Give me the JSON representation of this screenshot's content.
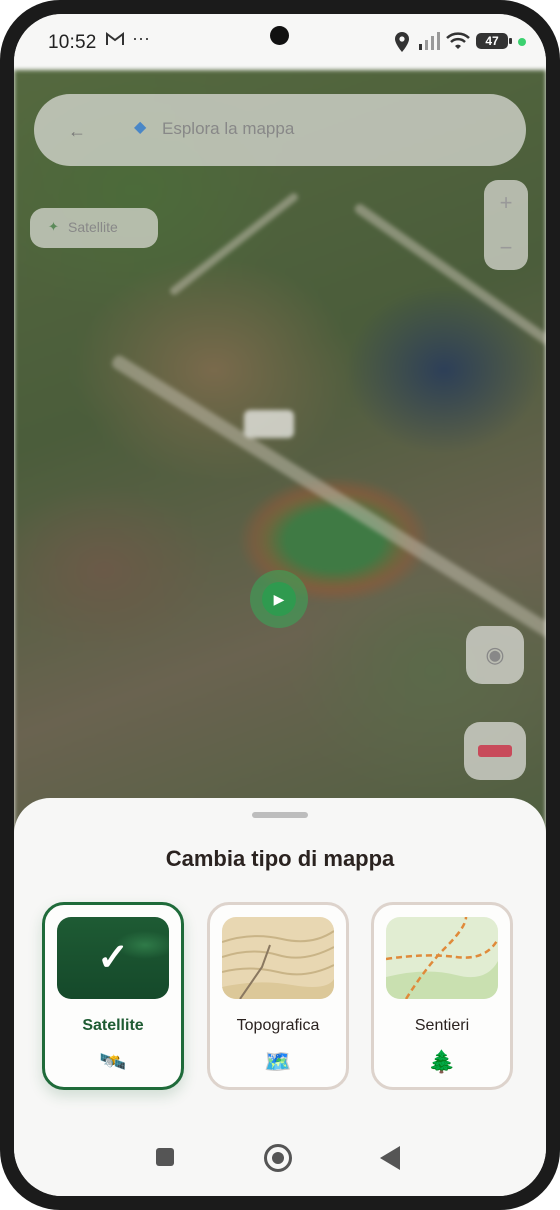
{
  "status_bar": {
    "time": "10:52",
    "notification_icons": [
      "gmail-icon",
      "more-dots-icon"
    ],
    "system_icons": [
      "location-icon",
      "signal-icon",
      "wifi-icon",
      "battery-icon"
    ],
    "battery_level": "47",
    "privacy_indicator_color": "#3bd16f"
  },
  "search": {
    "placeholder": "Esplora la mappa"
  },
  "map": {
    "layer_chip_label": "Satellite",
    "zoom_in_label": "+",
    "zoom_out_label": "−"
  },
  "sheet": {
    "title": "Cambia tipo di mappa",
    "options": [
      {
        "label": "Satellite",
        "icon": "🛰️",
        "selected": true
      },
      {
        "label": "Topografica",
        "icon": "🗺️",
        "selected": false
      },
      {
        "label": "Sentieri",
        "icon": "🌲",
        "selected": false
      }
    ],
    "selected_check": "✓"
  },
  "colors": {
    "accent": "#1f6b3a",
    "card_border": "#ddd3cc",
    "title": "#2b2320"
  }
}
